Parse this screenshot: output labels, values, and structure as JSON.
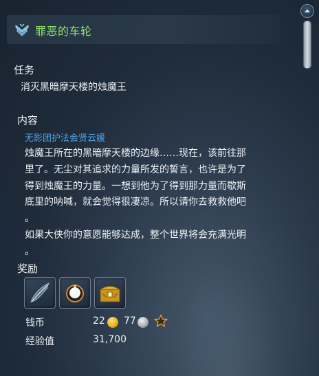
{
  "title": "罪恶的车轮",
  "task": {
    "heading": "任务",
    "text": "消灭黑暗摩天楼的烛魔王"
  },
  "content": {
    "heading": "内容",
    "speaker": "无影团护法会贤云媛",
    "lines": [
      "烛魔王所在的黑暗摩天楼的边缘……现在，该前往那",
      "里了。无尘对其追求的力量所发的誓言，也许是为了",
      "得到烛魔王的力量。一想到他为了得到那力量而歇斯",
      "底里的呐喊，就会觉得很凄凉。所以请你去救救他吧",
      "。",
      "如果大侠你的意愿能够达成，整个世界将会充满光明",
      "。"
    ]
  },
  "rewards": {
    "heading": "奖励",
    "items": [
      {
        "icon": "feather-item-icon"
      },
      {
        "icon": "orb-item-icon"
      },
      {
        "icon": "treasure-chest-icon"
      }
    ],
    "money_label": "钱币",
    "gold": "22",
    "silver": "77",
    "exp_label": "经验值",
    "exp_value": "31,700"
  },
  "colors": {
    "title": "#8fe070",
    "speaker": "#4fa3e6",
    "gold_coin": "#e8b420",
    "silver_coin": "#a9b1b9"
  }
}
